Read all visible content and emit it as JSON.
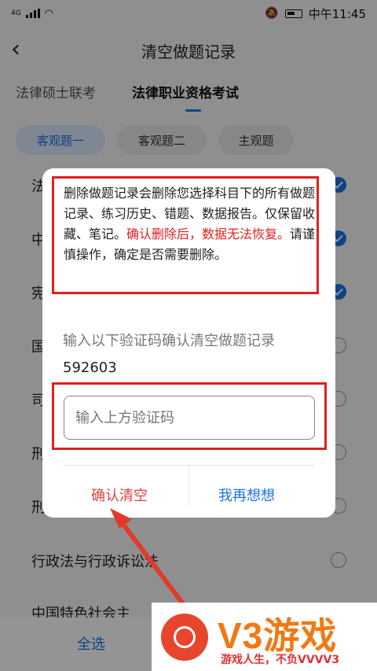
{
  "status_bar": {
    "network": "4G",
    "time": "中午11:45"
  },
  "header": {
    "title": "清空做题记录"
  },
  "tabs": [
    {
      "label": "法律硕士联考"
    },
    {
      "label": "法律职业资格考试"
    }
  ],
  "chips": [
    {
      "label": "客观题一"
    },
    {
      "label": "客观题二"
    },
    {
      "label": "主观题"
    }
  ],
  "list_items": [
    {
      "label": "法理学",
      "checked": true
    },
    {
      "label": "中",
      "checked": true
    },
    {
      "label": "宪",
      "checked": true
    },
    {
      "label": "国",
      "checked": false
    },
    {
      "label": "司",
      "checked": false
    },
    {
      "label": "刑",
      "checked": false
    },
    {
      "label": "刑",
      "checked": false
    },
    {
      "label": "行政法与行政诉讼法",
      "checked": false
    },
    {
      "label": "中国特色社会主",
      "checked": false
    }
  ],
  "bottom_bar": {
    "select_all": "全选"
  },
  "dialog": {
    "warning_part1": "删除做题记录会删除您选择科目下的所有做题记录、练习历史、错题、数据报告。仅保留收藏、笔记。",
    "warning_red": "确认删除后，数据无法恢复。",
    "warning_part2": "请谨慎操作，确定是否需要删除。",
    "prompt": "输入以下验证码确认清空做题记录",
    "code": "592603",
    "input_placeholder": "输入上方验证码",
    "confirm_label": "确认清空",
    "cancel_label": "我再想想"
  },
  "watermark": {
    "brand": "V3游戏",
    "slogan": "游戏人生，不负VVVV3"
  },
  "colors": {
    "accent": "#1a73e8",
    "danger": "#e02020",
    "watermark_orange": "#f07a12"
  }
}
